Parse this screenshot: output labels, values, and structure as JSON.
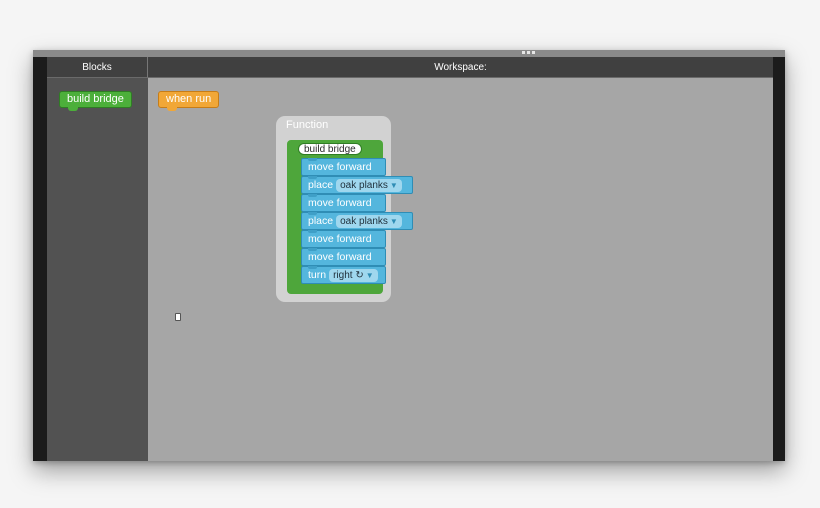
{
  "sidebar": {
    "header": "Blocks",
    "blocks": [
      {
        "label": "build bridge",
        "color": "#4caf3a"
      }
    ]
  },
  "workspace": {
    "header": "Workspace:",
    "event_block": {
      "label": "when run",
      "color": "#f1a737"
    },
    "function": {
      "title": "Function",
      "name": "build bridge",
      "statements": [
        {
          "text": "move forward"
        },
        {
          "text": "place",
          "field": "oak planks"
        },
        {
          "text": "move forward"
        },
        {
          "text": "place",
          "field": "oak planks"
        },
        {
          "text": "move forward"
        },
        {
          "text": "move forward"
        },
        {
          "text": "turn",
          "field": "right ↻"
        }
      ]
    }
  },
  "icons": {
    "dropdown": "▼"
  },
  "colors": {
    "statement": "#54b6dd",
    "function_def": "#4ea63b"
  }
}
